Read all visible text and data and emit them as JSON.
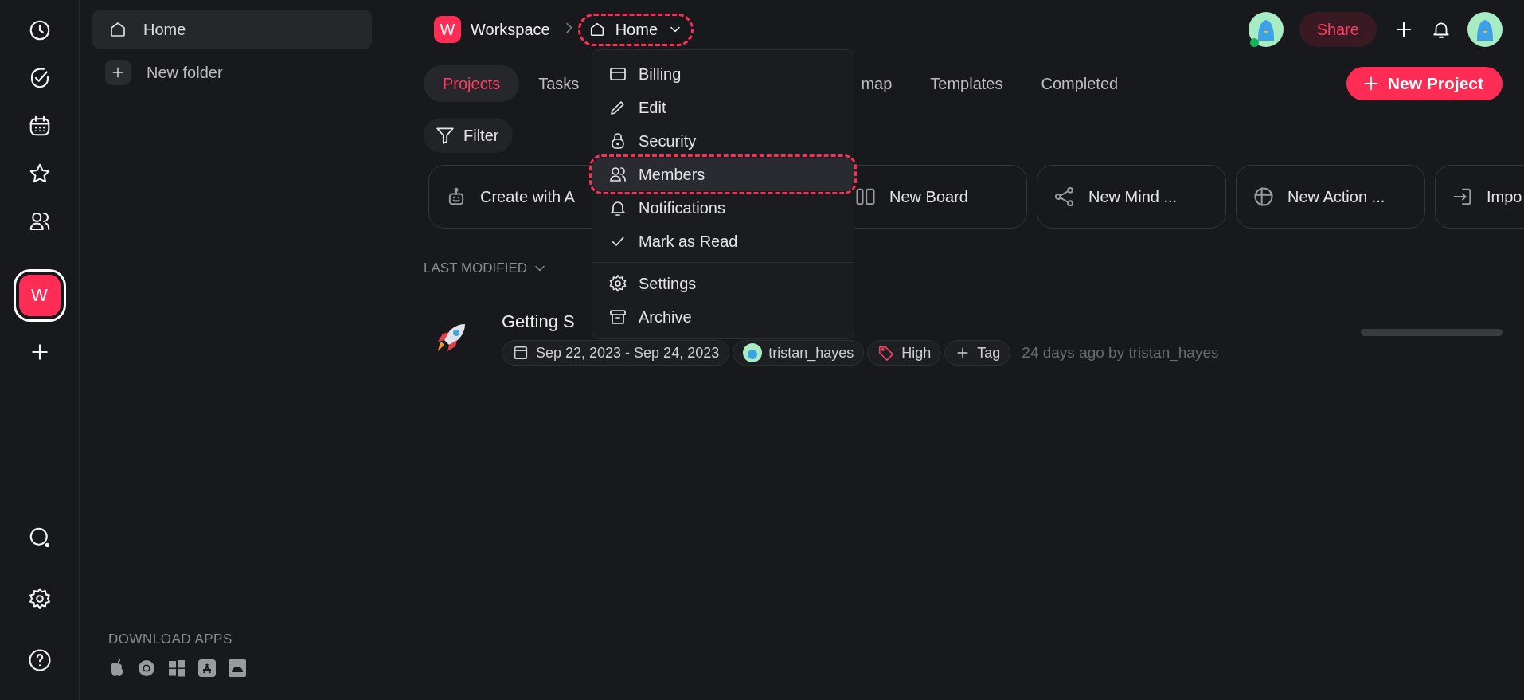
{
  "rail": {
    "workspaces": [
      {
        "initial": "W",
        "selected": true
      }
    ]
  },
  "sidebar": {
    "items": [
      {
        "label": "Home",
        "selected": true
      }
    ],
    "new_folder": "New folder",
    "download_title": "DOWNLOAD APPS"
  },
  "breadcrumb": [
    {
      "kind": "workspace",
      "initial": "W",
      "label": "Workspace",
      "highlighted": false
    },
    {
      "kind": "folder",
      "label": "Home",
      "highlighted": true
    }
  ],
  "header": {
    "members_avatar": {
      "online": true
    },
    "share": "Share"
  },
  "tabs": [
    {
      "kind": "tab",
      "label": "Projects",
      "selected": true
    },
    {
      "kind": "tab",
      "label": "Tasks",
      "selected": false
    },
    {
      "kind": "partial",
      "label": "map",
      "selected": false
    },
    {
      "kind": "tab",
      "label": "Templates",
      "selected": false
    },
    {
      "kind": "tab",
      "label": "Completed",
      "selected": false
    }
  ],
  "new_project": "New Project",
  "filter": "Filter",
  "quick_actions": [
    {
      "label": "Create with A"
    },
    {
      "label": "New Board"
    },
    {
      "label": "New Mind ..."
    },
    {
      "label": "New Action ..."
    },
    {
      "label": "Impo"
    }
  ],
  "sort": {
    "label": "LAST MODIFIED"
  },
  "project": {
    "title": "Getting S",
    "date": "Sep 22, 2023 - Sep 24, 2023",
    "owner": "tristan_hayes",
    "priority": "High",
    "add_tag": "Tag",
    "meta": "24 days ago by tristan_hayes",
    "level": 0
  },
  "menu": {
    "sections": [
      {
        "items": [
          {
            "label": "Billing",
            "selected": false
          },
          {
            "label": "Edit",
            "selected": false
          },
          {
            "label": "Security",
            "selected": false
          },
          {
            "label": "Members",
            "selected": true
          },
          {
            "label": "Notifications",
            "selected": false
          },
          {
            "label": "Mark as Read",
            "selected": false
          }
        ]
      },
      {
        "items": [
          {
            "label": "Settings",
            "selected": false
          },
          {
            "label": "Archive",
            "selected": false
          }
        ]
      }
    ]
  }
}
